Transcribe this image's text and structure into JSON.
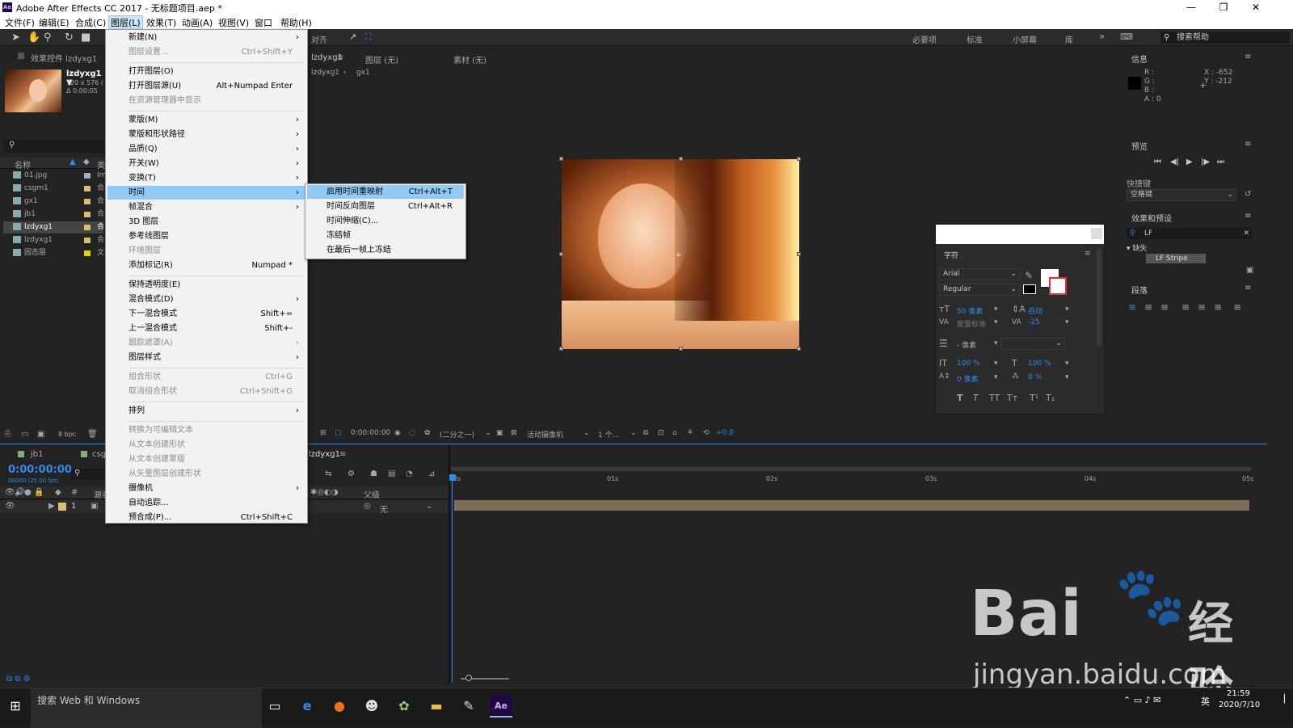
{
  "window": {
    "title": "Adobe After Effects CC 2017 - 无标题项目.aep *",
    "app_icon": "Ae"
  },
  "menubar": [
    "文件(F)",
    "编辑(E)",
    "合成(C)",
    "图层(L)",
    "效果(T)",
    "动画(A)",
    "视图(V)",
    "窗口",
    "帮助(H)"
  ],
  "toolbar": {
    "align_label": "对齐",
    "workspaces": [
      "必要项",
      "标准",
      "小屏幕",
      "库"
    ],
    "help_search": "搜索帮助"
  },
  "project_panel": {
    "tab_effects": "效果控件 lzdyxg1",
    "item_name": "lzdyxg1 ▼",
    "item_info": "720 x 576 (",
    "item_duration": "Δ 0:00:05",
    "col_name": "名称",
    "col_type": "类",
    "bpc": "8 bpc",
    "items": [
      {
        "name": "01.jpg",
        "type": "Im",
        "color": "#a8a8c0"
      },
      {
        "name": "csgm1",
        "type": "合",
        "color": "#d6c070"
      },
      {
        "name": "gx1",
        "type": "合",
        "color": "#d6c070"
      },
      {
        "name": "jb1",
        "type": "合",
        "color": "#d6c070"
      },
      {
        "name": "lzdyxg1",
        "type": "合",
        "color": "#d6c070"
      },
      {
        "name": "lzdyxg1",
        "type": "合",
        "color": "#d6c070"
      },
      {
        "name": "固态层",
        "type": "文",
        "color": "#e6d000"
      }
    ]
  },
  "comp_panel": {
    "tab_name": "lzdyxg1",
    "layer_tab": "图层 (无)",
    "footage_tab": "素材 (无)",
    "breadcrumb_1": "lzdyxg1",
    "breadcrumb_2": "gx1"
  },
  "viewer_bar": {
    "timecode": "0:00:00:00",
    "resolution": "(二分之一)",
    "camera": "活动摄像机",
    "views": "1 个...",
    "exposure": "+0.0"
  },
  "character_panel": {
    "title": "字符",
    "font": "Arial",
    "style": "Regular",
    "font_size": "50 像素",
    "leading": "自动",
    "kerning": "度量标准",
    "tracking": "-25",
    "stroke": "- 像素",
    "vscale": "100 %",
    "hscale": "100 %",
    "baseline": "0 像素",
    "tsume": "0 %",
    "styles": [
      "T",
      "T",
      "TT",
      "Tт",
      "T¹",
      "T₁"
    ]
  },
  "info_panel": {
    "title": "信息",
    "r": "R :",
    "g": "G :",
    "b": "B :",
    "a": "A : 0",
    "x": "X : -652",
    "y": "Y : -212"
  },
  "preview_panel": {
    "title": "预览",
    "shortcut_label": "快捷键",
    "shortcut_value": "空格键"
  },
  "effects_panel": {
    "title": "效果和预设",
    "search": "LF",
    "category": "▾ 缺失",
    "result": "LF Stripe"
  },
  "paragraph_panel": {
    "title": "段落"
  },
  "timeline": {
    "tabs": [
      "jb1",
      "csgm1",
      "lzdyxg1"
    ],
    "timecode": "0:00:00:00",
    "fps": "00000 (25.00 fps)",
    "source_name_header": "源名称",
    "parent_header": "父级",
    "parent_value": "无",
    "layer_number": "1",
    "ticks": [
      "0s",
      "01s",
      "02s",
      "03s",
      "04s",
      "05s"
    ]
  },
  "layer_menu": [
    {
      "label": "新建(N)",
      "shortcut": "",
      "arrow": true,
      "disabled": false
    },
    {
      "label": "图层设置...",
      "shortcut": "Ctrl+Shift+Y",
      "arrow": false,
      "disabled": true
    },
    {
      "sep": true
    },
    {
      "label": "打开图层(O)",
      "shortcut": "",
      "arrow": false,
      "disabled": false
    },
    {
      "label": "打开图层源(U)",
      "shortcut": "Alt+Numpad Enter",
      "arrow": false,
      "disabled": false
    },
    {
      "label": "在资源管理器中显示",
      "shortcut": "",
      "arrow": false,
      "disabled": true
    },
    {
      "sep": true
    },
    {
      "label": "蒙版(M)",
      "shortcut": "",
      "arrow": true,
      "disabled": false
    },
    {
      "label": "蒙版和形状路径",
      "shortcut": "",
      "arrow": true,
      "disabled": false
    },
    {
      "label": "品质(Q)",
      "shortcut": "",
      "arrow": true,
      "disabled": false
    },
    {
      "label": "开关(W)",
      "shortcut": "",
      "arrow": true,
      "disabled": false
    },
    {
      "label": "变换(T)",
      "shortcut": "",
      "arrow": true,
      "disabled": false
    },
    {
      "label": "时间",
      "shortcut": "",
      "arrow": true,
      "disabled": false,
      "highlight": true
    },
    {
      "label": "帧混合",
      "shortcut": "",
      "arrow": true,
      "disabled": false
    },
    {
      "label": "3D 图层",
      "shortcut": "",
      "arrow": false,
      "disabled": false
    },
    {
      "label": "参考线图层",
      "shortcut": "",
      "arrow": false,
      "disabled": false
    },
    {
      "label": "环境图层",
      "shortcut": "",
      "arrow": false,
      "disabled": true
    },
    {
      "label": "添加标记(R)",
      "shortcut": "Numpad *",
      "arrow": false,
      "disabled": false
    },
    {
      "sep": true
    },
    {
      "label": "保持透明度(E)",
      "shortcut": "",
      "arrow": false,
      "disabled": false
    },
    {
      "label": "混合模式(D)",
      "shortcut": "",
      "arrow": true,
      "disabled": false
    },
    {
      "label": "下一混合模式",
      "shortcut": "Shift+=",
      "arrow": false,
      "disabled": false
    },
    {
      "label": "上一混合模式",
      "shortcut": "Shift+-",
      "arrow": false,
      "disabled": false
    },
    {
      "label": "跟踪遮罩(A)",
      "shortcut": "",
      "arrow": true,
      "disabled": true
    },
    {
      "label": "图层样式",
      "shortcut": "",
      "arrow": true,
      "disabled": false
    },
    {
      "sep": true
    },
    {
      "label": "组合形状",
      "shortcut": "Ctrl+G",
      "arrow": false,
      "disabled": true
    },
    {
      "label": "取消组合形状",
      "shortcut": "Ctrl+Shift+G",
      "arrow": false,
      "disabled": true
    },
    {
      "sep": true
    },
    {
      "label": "排列",
      "shortcut": "",
      "arrow": true,
      "disabled": false
    },
    {
      "sep": true
    },
    {
      "label": "转换为可编辑文本",
      "shortcut": "",
      "arrow": false,
      "disabled": true
    },
    {
      "label": "从文本创建形状",
      "shortcut": "",
      "arrow": false,
      "disabled": true
    },
    {
      "label": "从文本创建蒙版",
      "shortcut": "",
      "arrow": false,
      "disabled": true
    },
    {
      "label": "从矢量图层创建形状",
      "shortcut": "",
      "arrow": false,
      "disabled": true
    },
    {
      "label": "摄像机",
      "shortcut": "",
      "arrow": true,
      "disabled": false
    },
    {
      "label": "自动追踪...",
      "shortcut": "",
      "arrow": false,
      "disabled": false
    },
    {
      "label": "预合成(P)...",
      "shortcut": "Ctrl+Shift+C",
      "arrow": false,
      "disabled": false
    }
  ],
  "time_submenu": [
    {
      "label": "启用时间重映射",
      "shortcut": "Ctrl+Alt+T",
      "highlight": true
    },
    {
      "label": "时间反向图层",
      "shortcut": "Ctrl+Alt+R"
    },
    {
      "label": "时间伸缩(C)...",
      "shortcut": ""
    },
    {
      "label": "冻结帧",
      "shortcut": ""
    },
    {
      "label": "在最后一帧上冻结",
      "shortcut": ""
    }
  ],
  "taskbar": {
    "search": "搜索 Web 和 Windows",
    "time": "21:59",
    "date": "2020/7/10",
    "ime": "英"
  },
  "watermark": {
    "logo": "Bai",
    "suffix": "经验",
    "url": "jingyan.baidu.com"
  }
}
